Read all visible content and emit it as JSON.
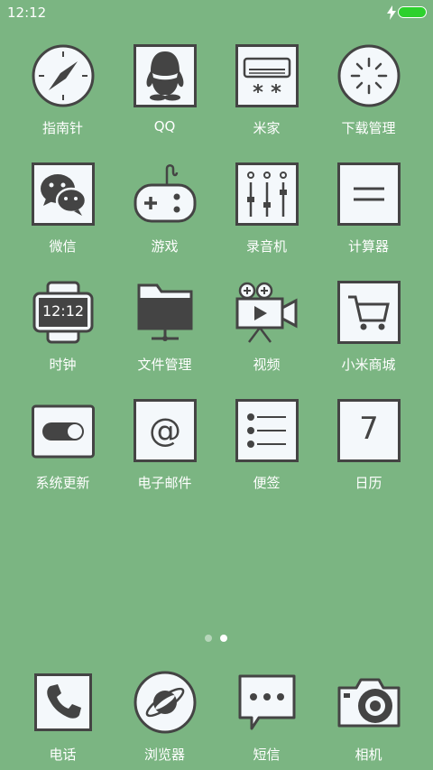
{
  "status": {
    "time": "12:12",
    "battery_color": "#2dd12d"
  },
  "apps": [
    {
      "label": "指南针",
      "icon": "compass-icon"
    },
    {
      "label": "QQ",
      "icon": "qq-penguin-icon"
    },
    {
      "label": "米家",
      "icon": "air-conditioner-icon"
    },
    {
      "label": "下载管理",
      "icon": "loading-spinner-icon"
    },
    {
      "label": "微信",
      "icon": "wechat-icon"
    },
    {
      "label": "游戏",
      "icon": "gamepad-icon"
    },
    {
      "label": "录音机",
      "icon": "mixer-sliders-icon"
    },
    {
      "label": "计算器",
      "icon": "equals-icon"
    },
    {
      "label": "时钟",
      "icon": "watch-icon",
      "clock_text": "12:12"
    },
    {
      "label": "文件管理",
      "icon": "folder-icon"
    },
    {
      "label": "视频",
      "icon": "video-camera-icon"
    },
    {
      "label": "小米商城",
      "icon": "shopping-cart-icon"
    },
    {
      "label": "系统更新",
      "icon": "toggle-switch-icon"
    },
    {
      "label": "电子邮件",
      "icon": "at-sign-icon"
    },
    {
      "label": "便签",
      "icon": "list-icon"
    },
    {
      "label": "日历",
      "icon": "calendar-icon",
      "day": "7"
    }
  ],
  "page_indicator": {
    "count": 2,
    "active": 2
  },
  "dock": [
    {
      "label": "电话",
      "icon": "phone-icon"
    },
    {
      "label": "浏览器",
      "icon": "planet-icon"
    },
    {
      "label": "短信",
      "icon": "message-bubble-icon"
    },
    {
      "label": "相机",
      "icon": "camera-icon"
    }
  ]
}
